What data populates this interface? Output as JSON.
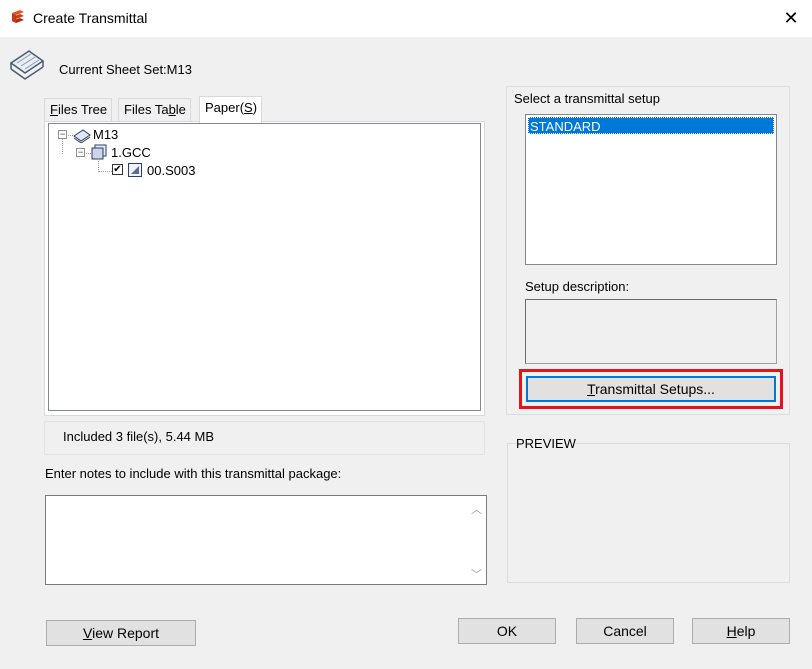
{
  "window": {
    "title": "Create Transmittal",
    "close_glyph": "✕",
    "app_icon": "app-logo-icon"
  },
  "header": {
    "current_sheet_set": "Current Sheet Set:M13",
    "icon": "sheet-set-icon"
  },
  "tabs": [
    {
      "label": "Files Tree",
      "underline": "F",
      "rest": "iles Tree",
      "active": false
    },
    {
      "label": "Files Table",
      "pre": "Files Ta",
      "underline": "b",
      "rest": "le",
      "active": false
    },
    {
      "label": "Paper(S)",
      "pre": "Paper(",
      "underline": "S",
      "rest": ")",
      "active": true
    }
  ],
  "tree": {
    "root": {
      "label": "M13",
      "expander": "−",
      "icon": "sheet-set-node-icon"
    },
    "child": {
      "label": "1.GCC",
      "expander": "−",
      "icon": "subset-node-icon"
    },
    "leaf": {
      "label": "00.S003",
      "checked": true,
      "check_glyph": "✔",
      "icon": "sheet-node-icon"
    }
  },
  "included_text": "Included 3 file(s), 5.44 MB",
  "notes": {
    "label": "Enter notes to include with this transmittal package:",
    "value": "",
    "scroll_up": "︿",
    "scroll_down": "﹀"
  },
  "setup": {
    "label": "Select a transmittal setup",
    "items": [
      "STANDARD"
    ],
    "selected": "STANDARD",
    "description_label": "Setup description:",
    "description": "",
    "setups_button": {
      "underline": "T",
      "rest": "ransmittal Setups..."
    }
  },
  "preview_label": "PREVIEW",
  "buttons": {
    "view_report": {
      "underline": "V",
      "rest": "iew Report"
    },
    "ok": "OK",
    "cancel": "Cancel",
    "help": {
      "underline": "H",
      "rest": "elp"
    }
  },
  "colors": {
    "selection": "#0078d7",
    "highlight_border": "#e5141c",
    "background": "#f0f0f0"
  }
}
